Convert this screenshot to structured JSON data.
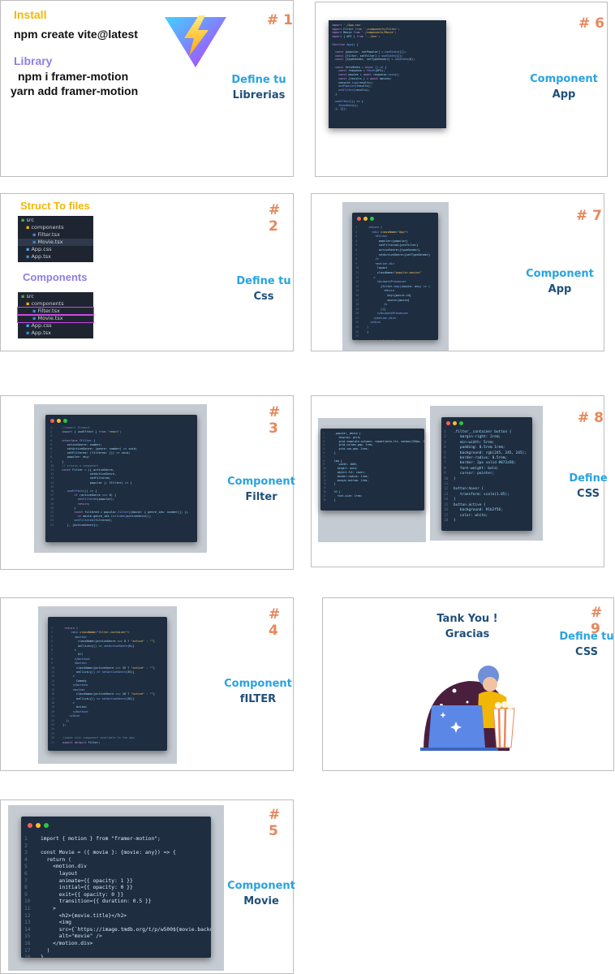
{
  "slides": [
    {
      "number": "# 1",
      "install_heading": "Install",
      "install_cmd": "npm create vite@latest",
      "library_heading": "Library",
      "library_cmd1": "npm i framer-motion",
      "library_cmd2": "yarn add framer-motion",
      "label_top": "Define tu",
      "label_bottom": "Librerias"
    },
    {
      "number": "# 2",
      "struct_heading": "Struct To files",
      "components_heading": "Components",
      "tree1": [
        "src",
        "components",
        "Filter.tsx",
        "Movie.tsx",
        "App.css",
        "App.tsx"
      ],
      "tree2": [
        "src",
        "components",
        "Filter.tsx",
        "Movie.tsx",
        "App.css",
        "App.tsx"
      ],
      "label_top": "Define tu",
      "label_bottom": "Css"
    },
    {
      "number": "# 3",
      "label_top": "Component",
      "label_bottom": "Filter"
    },
    {
      "number": "# 4",
      "label_top": "Component",
      "label_bottom": "fILTER"
    },
    {
      "number": "# 5",
      "label_top": "Component",
      "label_bottom": "Movie"
    },
    {
      "number": "# 6",
      "label_top": "Component",
      "label_bottom": "App"
    },
    {
      "number": "# 7",
      "label_top": "Component",
      "label_bottom": "App"
    },
    {
      "number": "# 8",
      "label_top": "Define",
      "label_bottom": "CSS"
    },
    {
      "number": "# 9",
      "thanks1": "Tank You !",
      "thanks2": "Gracias",
      "label_top": "Define tu",
      "label_bottom": "CSS"
    }
  ],
  "code": {
    "movie": [
      "import { motion } from \"framer-motion\";",
      "",
      "const Movie = ({ movie }: {movie: any}) => {",
      "  return (",
      "    <motion.div",
      "      layout",
      "      animate={{ opacity: 1 }}",
      "      initial={{ opacity: 0 }}",
      "      exit={{ opacity: 0 }}",
      "      transition={{ duration: 0.5 }}",
      "    >",
      "      <h2>{movie.title}</h2>",
      "      <img",
      "      src={`https://image.tmdb.org/t/p/w500${movie.backdrop_path}`}",
      "      alt=\"movie\" />",
      "    </motion.div>",
      "  )",
      "}",
      "",
      "export default Movie"
    ],
    "css_right": [
      ".filter__container button {",
      "   margin-right: 2rem;",
      "   min-width: 5rem;",
      "   padding: 0.5rem 1rem;",
      "   background: rgb(245, 245, 245);",
      "   border-radius: 0.5rem;",
      "   border: 2px solid #072a50;",
      "   font-weight: bold;",
      "   cursor: pointer;",
      "}",
      "",
      "button:hover {",
      "   transform: scale(1.05);",
      "}",
      "button.active {",
      "   background: #1b2f56;",
      "   color: white;",
      "}"
    ]
  }
}
